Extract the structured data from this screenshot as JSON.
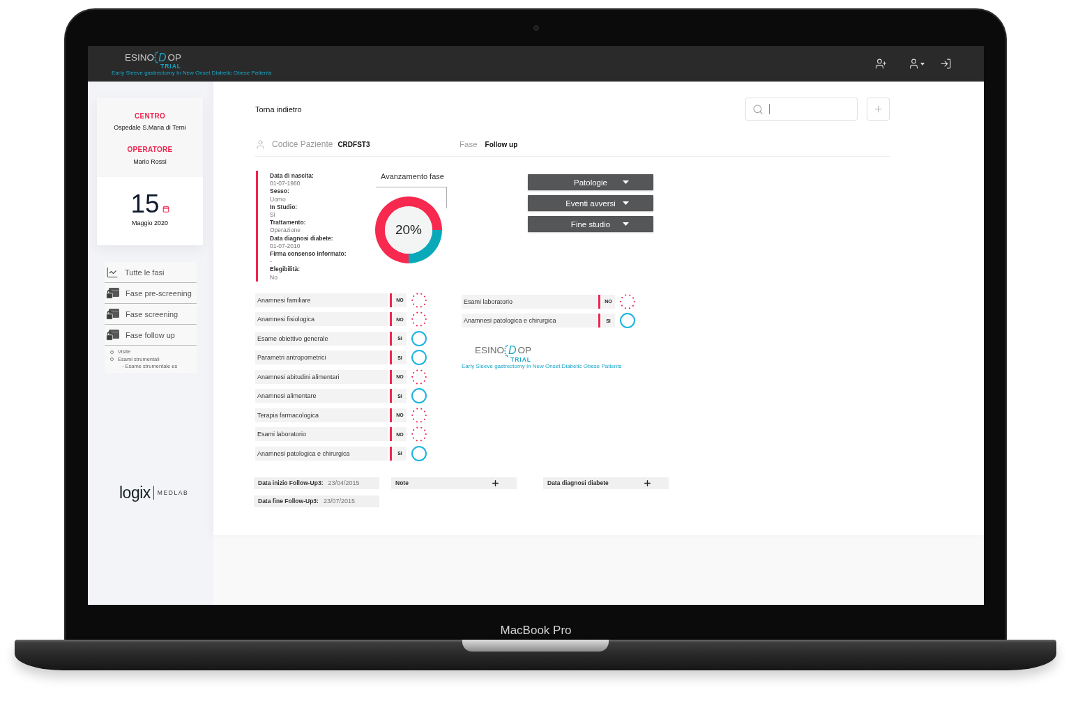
{
  "device": {
    "label": "MacBook Pro"
  },
  "header": {
    "logo": {
      "name_start": "ESINO",
      "name_mark": "D",
      "name_end": "OP",
      "subtitle": "TRIAL",
      "tagline": "Early Sleeve gastrectomy In New Onset Diabetic Obese Patients"
    }
  },
  "sidebar": {
    "center_label": "CENTRO",
    "center": "Ospedale S.Maria di Terni",
    "operator_label": "OPERATORE",
    "operator": "Mario Rossi",
    "day": "15",
    "month": "Maggio 2020",
    "nav": [
      {
        "label": "Tutte le fasi",
        "kind": "chart"
      },
      {
        "label": "Fase pre-screening",
        "kind": "locked"
      },
      {
        "label": "Fase screening",
        "kind": "locked"
      },
      {
        "label": "Fase follow up",
        "kind": "locked"
      }
    ],
    "sub_items": [
      {
        "label": "Visite"
      },
      {
        "label": "Esami strumentali",
        "children": [
          {
            "label": "- Esame strumentale es"
          }
        ]
      }
    ],
    "footer_logo": {
      "name": "logix",
      "subtitle": "MEDLAB"
    }
  },
  "main": {
    "back": "Torna indietro",
    "patient": {
      "code_label": "Codice Paziente",
      "code": "CRDFST3",
      "phase_label": "Fase",
      "phase": "Follow up"
    },
    "details": [
      {
        "label": "Data di nascita:",
        "value": "01-07-1980"
      },
      {
        "label": "Sesso:",
        "value": "Uomo"
      },
      {
        "label": "In Studio:",
        "value": "Si"
      },
      {
        "label": "Trattamento:",
        "value": "Operazione"
      },
      {
        "label": "Data diagnosi diabete:",
        "value": "01-07-2010"
      },
      {
        "label": "Firma consenso informato:",
        "value": "-"
      },
      {
        "label": "Elegibilità:",
        "value": "No"
      }
    ],
    "progress": {
      "reading": "20%",
      "chart_data": {
        "type": "donut",
        "title": "Avanzamento fase",
        "values": [
          25,
          75
        ]
      }
    },
    "actions": [
      {
        "label": "Patologie"
      },
      {
        "label": "Eventi avversi"
      },
      {
        "label": "Fine studio"
      }
    ],
    "checklist_left": [
      {
        "label": "Anamnesi familiare",
        "answer": "NO",
        "done": false
      },
      {
        "label": "Anamnesi fisiologica",
        "answer": "NO",
        "done": false
      },
      {
        "label": "Esame obiettivo generale",
        "answer": "SI",
        "done": true
      },
      {
        "label": "Parametri antropometrici",
        "answer": "SI",
        "done": true
      },
      {
        "label": "Anamnesi abitudini alimentari",
        "answer": "NO",
        "done": false
      },
      {
        "label": "Anamnesi alimentare",
        "answer": "SI",
        "done": true
      },
      {
        "label": "Terapia farmacologica",
        "answer": "NO",
        "done": false
      },
      {
        "label": "Esami laboratorio",
        "answer": "NO",
        "done": false
      },
      {
        "label": "Anamnesi patologica e chirurgica",
        "answer": "SI",
        "done": true
      }
    ],
    "checklist_right": [
      {
        "label": "Esami laboratorio",
        "answer": "NO",
        "done": false
      },
      {
        "label": "Anamnesi patologica e chirurgica",
        "answer": "SI",
        "done": true
      }
    ],
    "study_logo": {
      "name_start": "ESINO",
      "name_mark": "D",
      "name_end": "OP",
      "subtitle": "TRIAL",
      "tagline": "Early Sleeve gastrectomy In New Onset Diabetic Obese Patients"
    },
    "dates": [
      {
        "label": "Data inizio Follow-Up3:",
        "value": "23/04/2015"
      },
      {
        "label": "Data fine Follow-Up3:",
        "value": "23/07/2015"
      }
    ],
    "add_fields": [
      {
        "label": "Note"
      },
      {
        "label": "Data diagnosi diabete"
      }
    ]
  }
}
